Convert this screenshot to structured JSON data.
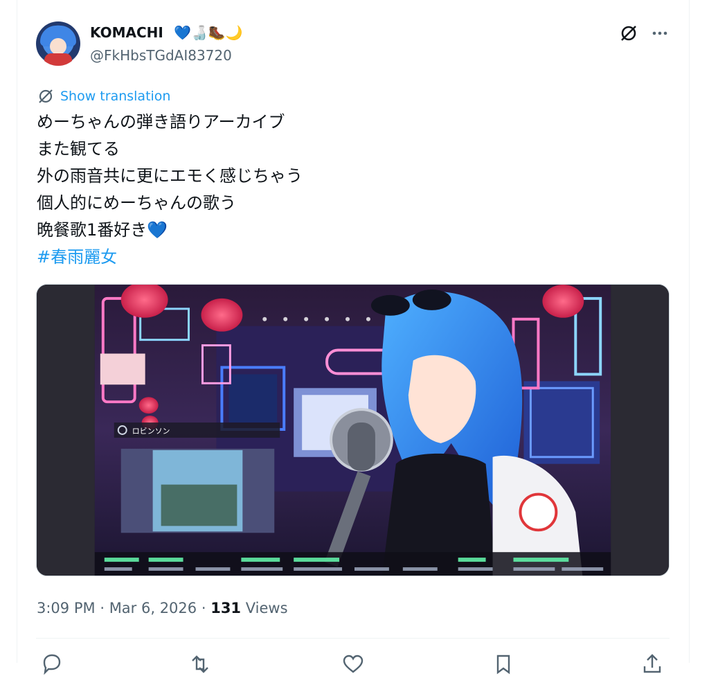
{
  "user": {
    "display_name": "KOMACHI",
    "name_emojis": "💙🍶🥾🌙",
    "handle": "@FkHbsTGdAI83720"
  },
  "icons": {
    "header": [
      "grok-icon",
      "more-icon"
    ],
    "translate": "translate-icon",
    "actions": [
      "reply-icon",
      "retweet-icon",
      "like-icon",
      "bookmark-icon",
      "share-icon"
    ]
  },
  "translate": {
    "label": "Show translation"
  },
  "tweet": {
    "lines": [
      "めーちゃんの弾き語りアーカイブ",
      "また観てる",
      "外の雨音共に更にエモく感じちゃう",
      "個人的にめーちゃんの歌う",
      "晩餐歌1番好き"
    ],
    "line5_emoji": "💙",
    "hashtag": "#春雨麗女"
  },
  "media": {
    "overlay_label": "ロビンソン"
  },
  "meta": {
    "time": "3:09 PM",
    "separator": "·",
    "date": "Mar 6, 2026",
    "views_count": "131",
    "views_label": "Views"
  },
  "colors": {
    "accent": "#1d9bf0",
    "secondary_text": "#536471",
    "text": "#0f1419",
    "border": "#eff3f4"
  }
}
